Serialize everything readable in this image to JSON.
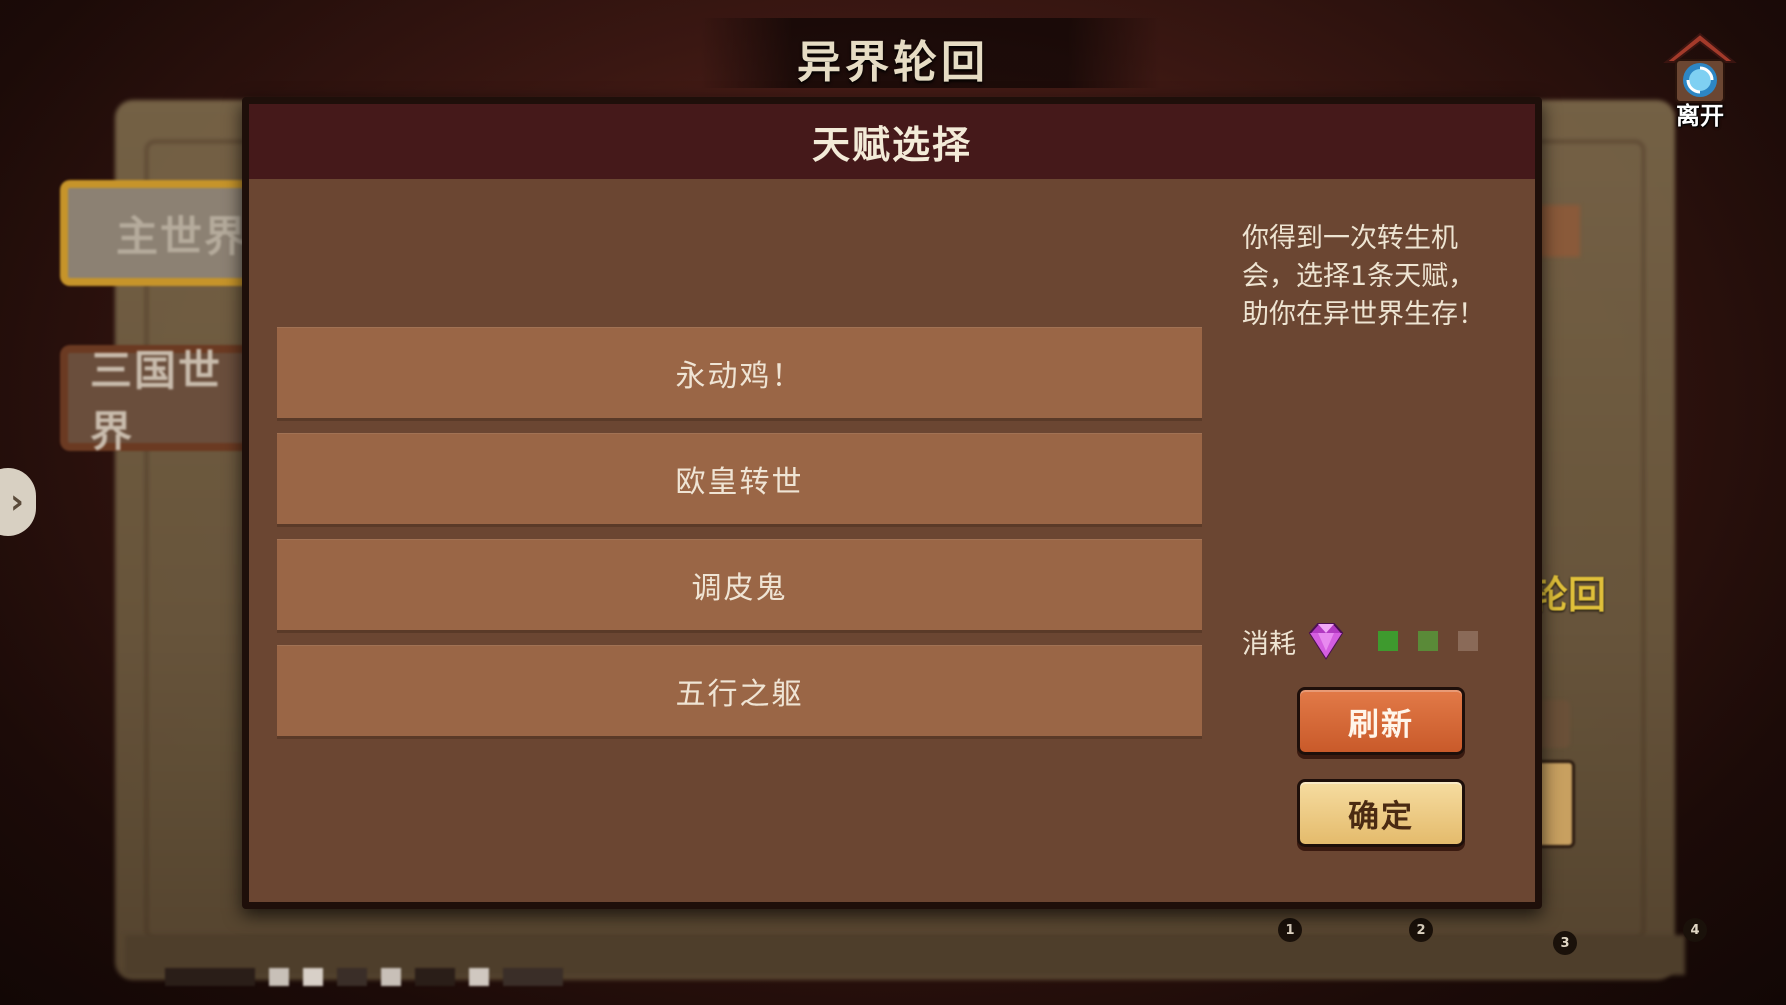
{
  "screen_title": "异界轮回",
  "leave": {
    "label": "离开",
    "icon": "portal-gate-icon"
  },
  "worlds": [
    {
      "label": "主世界"
    },
    {
      "label": "三国世界"
    }
  ],
  "side_arrow": "›",
  "background": {
    "right_label": "轮回"
  },
  "page_numbers": [
    "1",
    "2",
    "3",
    "4"
  ],
  "modal": {
    "title": "天赋选择",
    "talents": [
      {
        "label": "永动鸡！"
      },
      {
        "label": "欧皇转世"
      },
      {
        "label": "调皮鬼"
      },
      {
        "label": "五行之躯"
      }
    ],
    "description": "你得到一次转生机会，选择1条天赋，助你在异世界生存！",
    "cost": {
      "label": "消耗",
      "icon": "purple-gem-icon",
      "pips": [
        {
          "state": "filled",
          "color": "#3e9a2e"
        },
        {
          "state": "filled",
          "color": "#5a8a38"
        },
        {
          "state": "empty",
          "color": "#8a6a58"
        }
      ]
    },
    "refresh_label": "刷新",
    "confirm_label": "确定"
  },
  "colors": {
    "modal_bg": "#6b4632",
    "modal_header": "#45191a",
    "talent_bg": "#9a6646",
    "refresh": "#d8673a",
    "confirm": "#eccb84"
  }
}
